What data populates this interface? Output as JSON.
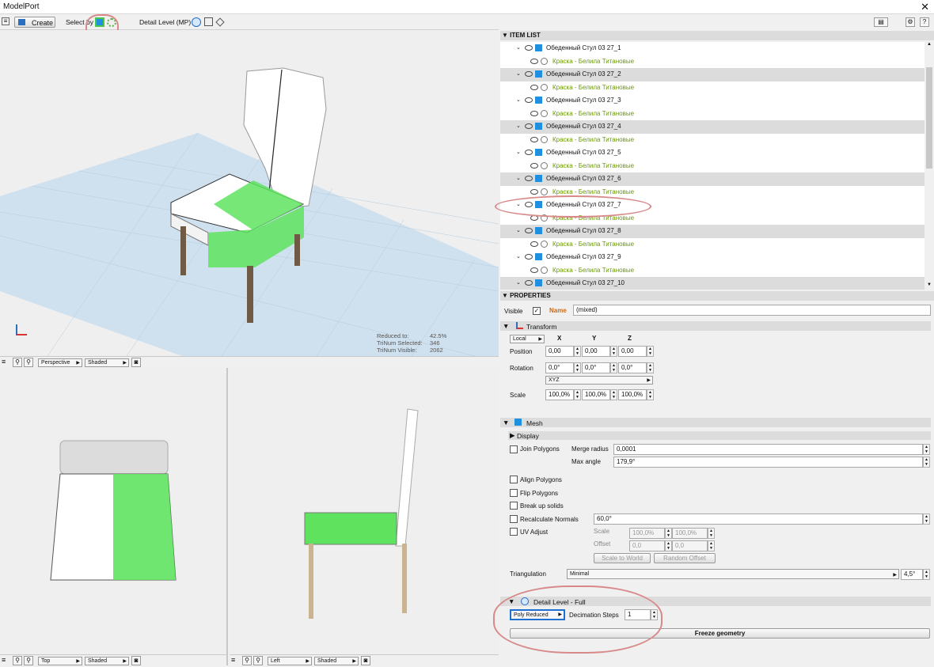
{
  "window": {
    "title": "ModelPort",
    "close": "✕"
  },
  "toolbar": {
    "create_label": "Create",
    "select_by_label": "Select by",
    "detail_level_label": "Detail Level (MP)"
  },
  "viewport_main": {
    "stats": {
      "reduced_label": "Reduced to:",
      "reduced_value": "42.5%",
      "selected_label": "TriNum Selected:",
      "selected_value": "346",
      "visible_label": "TriNum Visible:",
      "visible_value": "2062"
    },
    "view": "Perspective",
    "shading": "Shaded"
  },
  "viewport_top": {
    "view": "Top",
    "shading": "Shaded"
  },
  "viewport_left": {
    "view": "Left",
    "shading": "Shaded"
  },
  "item_list": {
    "title": "ITEM LIST",
    "items": [
      {
        "name": "Обеденный Стул 03 27_1",
        "material": "Краска - Белила Титановые"
      },
      {
        "name": "Обеденный Стул 03 27_2",
        "material": "Краска - Белила Титановые"
      },
      {
        "name": "Обеденный Стул 03 27_3",
        "material": "Краска - Белила Титановые"
      },
      {
        "name": "Обеденный Стул 03 27_4",
        "material": "Краска - Белила Титановые"
      },
      {
        "name": "Обеденный Стул 03 27_5",
        "material": "Краска - Белила Титановые"
      },
      {
        "name": "Обеденный Стул 03 27_6",
        "material": "Краска - Белила Титановые"
      },
      {
        "name": "Обеденный Стул 03 27_7",
        "material": "Краска - Белила Титановые"
      },
      {
        "name": "Обеденный Стул 03 27_8",
        "material": "Краска - Белила Титановые"
      },
      {
        "name": "Обеденный Стул 03 27_9",
        "material": "Краска - Белила Титановые"
      },
      {
        "name": "Обеденный Стул 03 27_10",
        "material": ""
      }
    ]
  },
  "properties": {
    "title": "PROPERTIES",
    "visible_label": "Visible",
    "name_label": "Name",
    "name_value": "(mixed)",
    "transform": {
      "title": "Transform",
      "space": "Local",
      "x": "X",
      "y": "Y",
      "z": "Z",
      "position_label": "Position",
      "position": [
        "0,00",
        "0,00",
        "0,00"
      ],
      "rotation_label": "Rotation",
      "rotation": [
        "0,0°",
        "0,0°",
        "0,0°"
      ],
      "order": "XYZ",
      "scale_label": "Scale",
      "scale": [
        "100,0%",
        "100,0%",
        "100,0%"
      ]
    },
    "mesh": {
      "title": "Mesh",
      "display_label": "Display",
      "join_polygons": "Join Polygons",
      "merge_radius_label": "Merge radius",
      "merge_radius": "0,0001",
      "max_angle_label": "Max angle",
      "max_angle": "179,9°",
      "align_polygons": "Align Polygons",
      "flip_polygons": "Flip Polygons",
      "break_up_solids": "Break up solids",
      "recalculate_normals": "Recalculate Normals",
      "normals_angle": "60,0°",
      "uv_adjust": "UV Adjust",
      "uv_scale_label": "Scale",
      "uv_scale": [
        "100,0%",
        "100,0%"
      ],
      "uv_offset_label": "Offset",
      "uv_offset": [
        "0,0",
        "0,0"
      ],
      "scale_to_world": "Scale to World",
      "random_offset": "Random Offset",
      "triangulation_label": "Triangulation",
      "triangulation": "Minimal",
      "triangulation_angle": "4,5°"
    },
    "detail": {
      "title": "Detail Level - Full",
      "mode": "Poly Reduced",
      "steps_label": "Decimation Steps",
      "steps": "1",
      "freeze": "Freeze geometry"
    }
  },
  "colors": {
    "accent": "#1e6fd0",
    "material_text": "#6a9a00",
    "selection": "#5fe35f",
    "annotation": "#d88a8a"
  }
}
